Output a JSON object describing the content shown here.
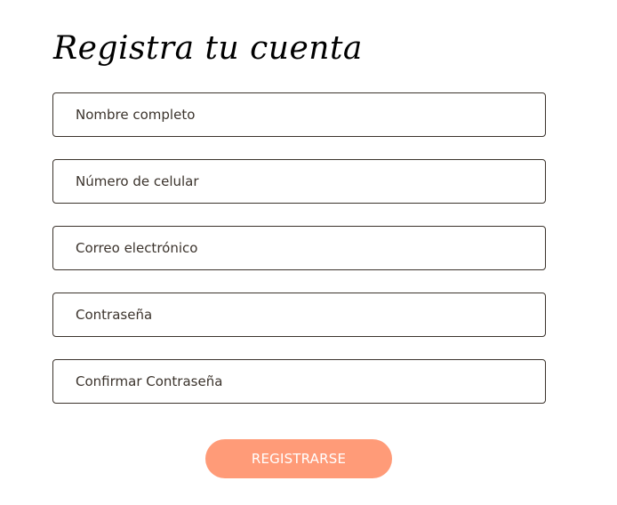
{
  "form": {
    "title": "Registra tu cuenta",
    "fields": [
      {
        "placeholder": "Nombre completo",
        "value": ""
      },
      {
        "placeholder": "Número de celular",
        "value": ""
      },
      {
        "placeholder": "Correo electrónico",
        "value": ""
      },
      {
        "placeholder": "Contraseña",
        "value": ""
      },
      {
        "placeholder": "Confirmar Contraseña",
        "value": ""
      }
    ],
    "submit_label": "REGISTRARSE"
  },
  "colors": {
    "field_border": "#3b332c",
    "field_text": "#3b332c",
    "button_bg": "#ff9b78",
    "button_text": "#ffffff",
    "title_text": "#000000"
  }
}
